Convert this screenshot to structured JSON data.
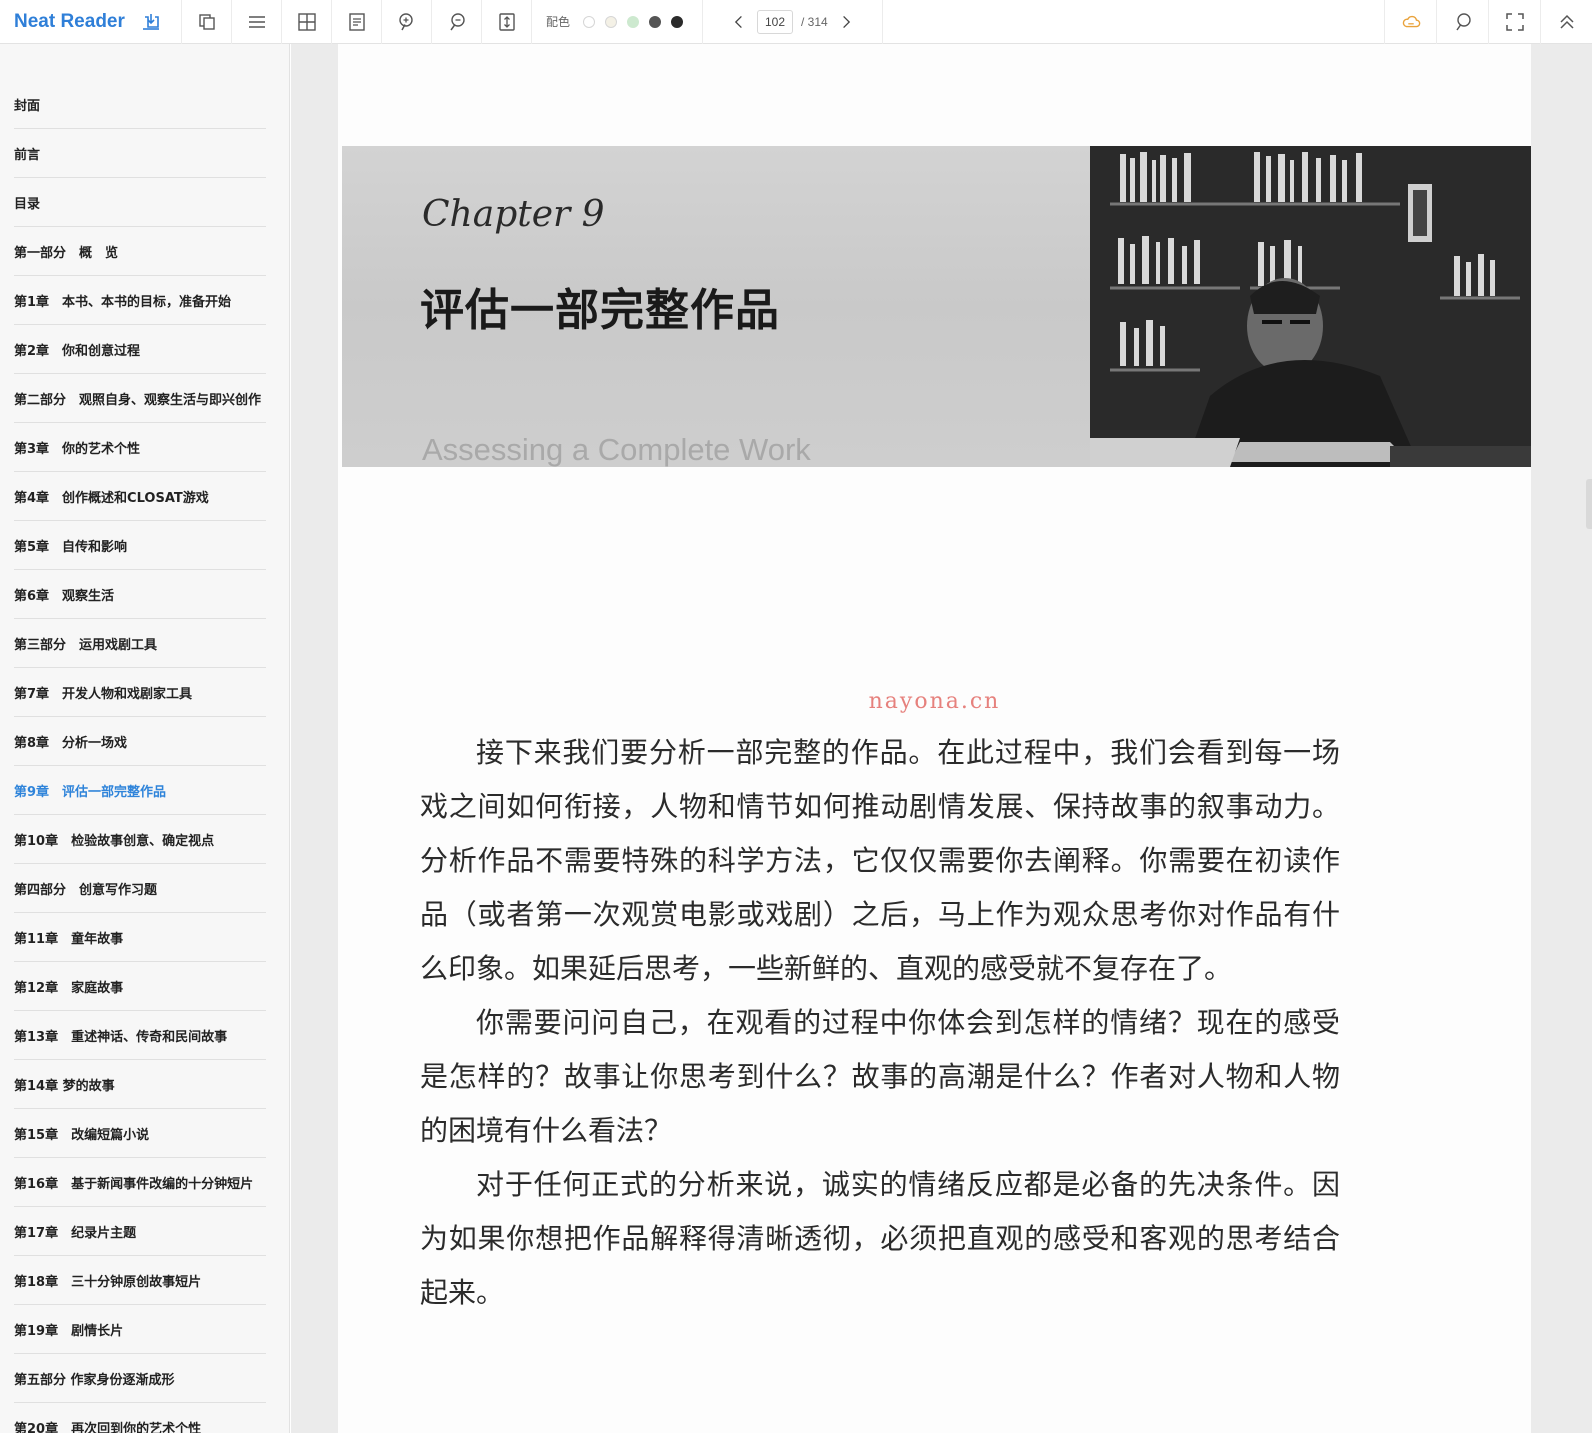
{
  "app": {
    "brand": "Neat Reader",
    "accent_color": "#2f7fd8"
  },
  "toolbar": {
    "color_label": "配色",
    "color_swatches": [
      "#ffffff",
      "#f4f1e6",
      "#cde9cf",
      "#555555",
      "#2b2b2b"
    ],
    "current_page": "102",
    "total_pages": "/ 314",
    "icons": [
      "import-icon",
      "copy-icon",
      "menu-icon",
      "grid-icon",
      "notes-icon",
      "zoom-in-icon",
      "zoom-out-icon",
      "fit-page-icon",
      "prev-page-icon",
      "next-page-icon",
      "cloud-icon",
      "search-icon",
      "fullscreen-icon",
      "collapse-up-icon"
    ]
  },
  "toc": [
    "封面",
    "前言",
    "目录",
    "第一部分　概　览",
    "第1章　本书、本书的目标，准备开始",
    "第2章　你和创意过程",
    "第二部分　观照自身、观察生活与即兴创作",
    "第3章　你的艺术个性",
    "第4章　创作概述和CLOSAT游戏",
    "第5章　自传和影响",
    "第6章　观察生活",
    "第三部分　运用戏剧工具",
    "第7章　开发人物和戏剧家工具",
    "第8章　分析一场戏",
    "第9章　评估一部完整作品",
    "第10章　检验故事创意、确定视点",
    "第四部分　创意写作习题",
    "第11章　童年故事",
    "第12章　家庭故事",
    "第13章　重述神话、传奇和民间故事",
    "第14章 梦的故事",
    "第15章　改编短篇小说",
    "第16章　基于新闻事件改编的十分钟短片",
    "第17章　纪录片主题",
    "第18章　三十分钟原创故事短片",
    "第19章　剧情长片",
    "第五部分 作家身份逐渐成形",
    "第20章　再次回到你的艺术个性"
  ],
  "toc_active_index": 14,
  "book_page": {
    "chapter_en": "Chapter 9",
    "chapter_cn": "评估一部完整作品",
    "chapter_subtitle": "Assessing a Complete Work",
    "watermark": "nayona.cn",
    "paragraphs": [
      "接下来我们要分析一部完整的作品。在此过程中，我们会看到每一场戏之间如何衔接，人物和情节如何推动剧情发展、保持故事的叙事动力。分析作品不需要特殊的科学方法，它仅仅需要你去阐释。你需要在初读作品（或者第一次观赏电影或戏剧）之后，马上作为观众思考你对作品有什么印象。如果延后思考，一些新鲜的、直观的感受就不复存在了。",
      "你需要问问自己，在观看的过程中你体会到怎样的情绪？现在的感受是怎样的？故事让你思考到什么？故事的高潮是什么？作者对人物和人物的困境有什么看法？",
      "对于任何正式的分析来说，诚实的情绪反应都是必备的先决条件。因为如果你想把作品解释得清晰透彻，必须把直观的感受和客观的思考结合起来。"
    ]
  }
}
